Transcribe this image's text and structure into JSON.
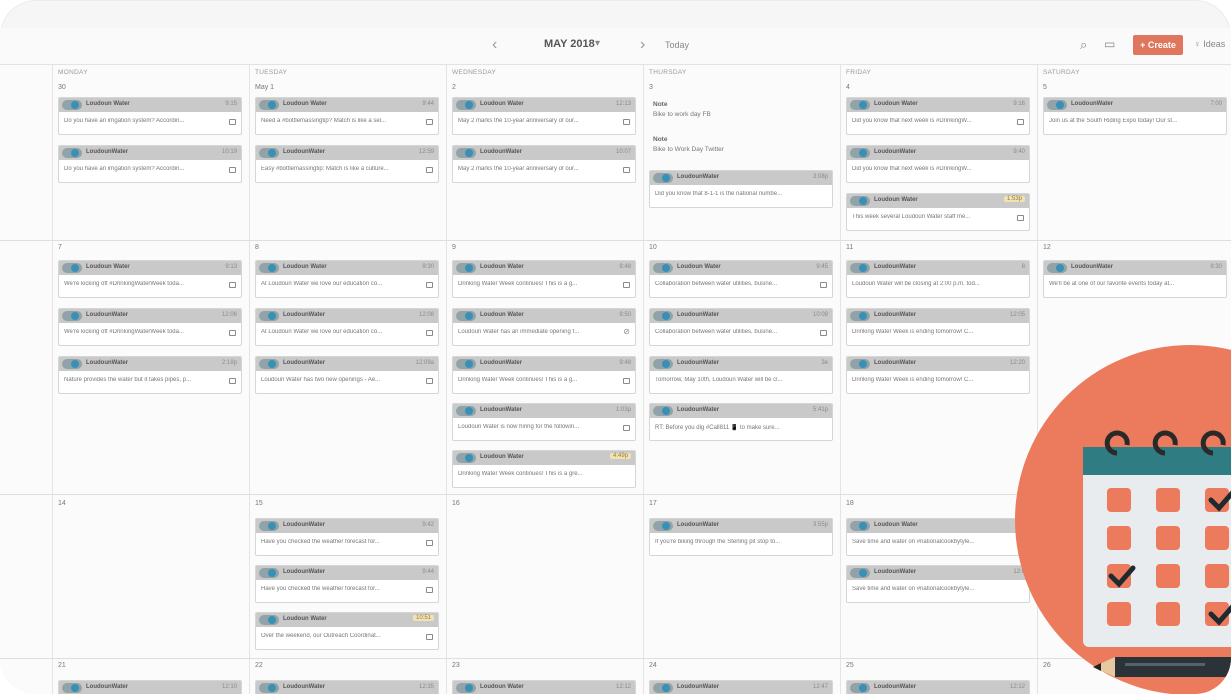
{
  "toolbar": {
    "month": "MAY 2018",
    "month_caret": "▾",
    "prev": "‹",
    "next": "›",
    "today": "Today",
    "search_icon": "⌕",
    "calendar_icon": "▭",
    "create": "+ Create",
    "ideas": "♀ Ideas"
  },
  "weekdays": [
    "MONDAY",
    "TUESDAY",
    "WEDNESDAY",
    "THURSDAY",
    "FRIDAY",
    "SATURDAY"
  ],
  "weeks": [
    {
      "days": [
        "30",
        "May 1",
        "2",
        "3",
        "4",
        "5"
      ]
    },
    {
      "days": [
        "7",
        "8",
        "9",
        "10",
        "11",
        "12"
      ]
    },
    {
      "days": [
        "14",
        "15",
        "16",
        "17",
        "18",
        ""
      ]
    },
    {
      "days": [
        "21",
        "22",
        "23",
        "24",
        "25",
        "26"
      ]
    }
  ],
  "notes": [
    {
      "title": "Note",
      "text": "Bike to work day FB"
    },
    {
      "title": "Note",
      "text": "Bike to Work Day Twitter"
    }
  ],
  "cards": [
    {
      "account": "Loudoun Water",
      "time": "9:15",
      "text": "Do you have an irrigation system? Accordin..."
    },
    {
      "account": "LoudounWater",
      "time": "10:19",
      "text": "Do you have an irrigation system? Accordin..."
    },
    {
      "account": "Loudoun Water",
      "time": "9:44",
      "text": "Need a #bottlemassingtip? Match is like a sel..."
    },
    {
      "account": "LoudounWater",
      "time": "12:59",
      "text": "Easy #bottlemassingtip: Match is like a culture..."
    },
    {
      "account": "Loudoun Water",
      "time": "12:13",
      "text": "May 2 marks the 10-year anniversary of our..."
    },
    {
      "account": "LoudounWater",
      "time": "10:07",
      "text": "May 2 marks the 10-year anniversary of our..."
    },
    {
      "account": "LoudounWater",
      "time": "3:08p",
      "text": "Did you know that 8-1-1 is the national numbe..."
    },
    {
      "account": "Loudoun Water",
      "time": "9:16",
      "text": "Did you know that next week is #DrinkingW..."
    },
    {
      "account": "LoudounWater",
      "time": "9:40",
      "text": "Did you know that next week is #DrinkingW..."
    },
    {
      "account": "Loudoun Water",
      "time": "1:53p",
      "text": "This week several Loudoun Water staff me..."
    },
    {
      "account": "LoudounWater",
      "time": "7:00",
      "text": "Join us at the South Riding Expo today! Our st..."
    },
    {
      "account": "Loudoun Water",
      "time": "9:13",
      "text": "We're kicking off #DrinkingWaterWeek toda..."
    },
    {
      "account": "LoudounWater",
      "time": "12:06",
      "text": "We're kicking off #DrinkingWaterWeek toda..."
    },
    {
      "account": "LoudounWater",
      "time": "2:18p",
      "text": "Nature provides the water but it takes pipes, p..."
    },
    {
      "account": "Loudoun Water",
      "time": "9:30",
      "text": "At Loudoun Water we love our education co..."
    },
    {
      "account": "LoudounWater",
      "time": "12:08",
      "text": "At Loudoun Water we love our education co..."
    },
    {
      "account": "LoudounWater",
      "time": "12:09a",
      "text": "Loudoun Water has two new openings - Ae..."
    },
    {
      "account": "Loudoun Water",
      "time": "8:48",
      "text": "Drinking Water Week continues! This is a g..."
    },
    {
      "account": "Loudoun Water",
      "time": "8:50",
      "text": "Loudoun Water has an immediate opening f..."
    },
    {
      "account": "LoudounWater",
      "time": "9:48",
      "text": "Drinking Water Week continues! This is a g..."
    },
    {
      "account": "LoudounWater",
      "time": "1:03p",
      "text": "Loudoun Water is now hiring for the followin..."
    },
    {
      "account": "Loudoun Water",
      "time": "4:49p",
      "text": "Drinking Water Week continues! This is a gre..."
    },
    {
      "account": "Loudoun Water",
      "time": "9:45",
      "text": "Collaboration between water utilities, busine..."
    },
    {
      "account": "LoudounWater",
      "time": "10:09",
      "text": "Collaboration between water utilities, busine..."
    },
    {
      "account": "LoudounWater",
      "time": "3e",
      "text": "Tomorrow, May 10th, Loudoun Water will be cl..."
    },
    {
      "account": "LoudounWater",
      "time": "5:41p",
      "text": "RT: Before you dig #Call811 📱 to make sure..."
    },
    {
      "account": "LoudounWater",
      "time": "8",
      "text": "Loudoun Water will be closing at 2:00 p.m. tod..."
    },
    {
      "account": "LoudounWater",
      "time": "12:05",
      "text": "Drinking Water Week is ending tomorrow! C..."
    },
    {
      "account": "LoudounWater",
      "time": "12:20",
      "text": "Drinking Water Week is ending tomorrow! C..."
    },
    {
      "account": "LoudounWater",
      "time": "8:30",
      "text": "We'll be at one of our favorite events today at..."
    },
    {
      "account": "LoudounWater",
      "time": "9:42",
      "text": "Have you checked the weather forecast for..."
    },
    {
      "account": "LoudounWater",
      "time": "9:44",
      "text": "Have you checked the weather forecast for..."
    },
    {
      "account": "Loudoun Water",
      "time": "10:51",
      "text": "Over the weekend, our Outreach Coordinat..."
    },
    {
      "account": "LoudounWater",
      "time": "3:55p",
      "text": "If you're biking through the Sterling pit stop to..."
    },
    {
      "account": "Loudoun Water",
      "time": "",
      "text": "Save time and water on #nationalcookbytyle..."
    },
    {
      "account": "LoudounWater",
      "time": "12:0",
      "text": "Save time and water on #nationalcookbytyle..."
    },
    {
      "account": "LoudounWater",
      "time": "12:10",
      "text": ""
    },
    {
      "account": "LoudounWater",
      "time": "12:35",
      "text": ""
    },
    {
      "account": "Loudoun Water",
      "time": "12:12",
      "text": ""
    },
    {
      "account": "LoudounWater",
      "time": "12:47",
      "text": ""
    },
    {
      "account": "LoudounWater",
      "time": "12:12",
      "text": ""
    }
  ]
}
